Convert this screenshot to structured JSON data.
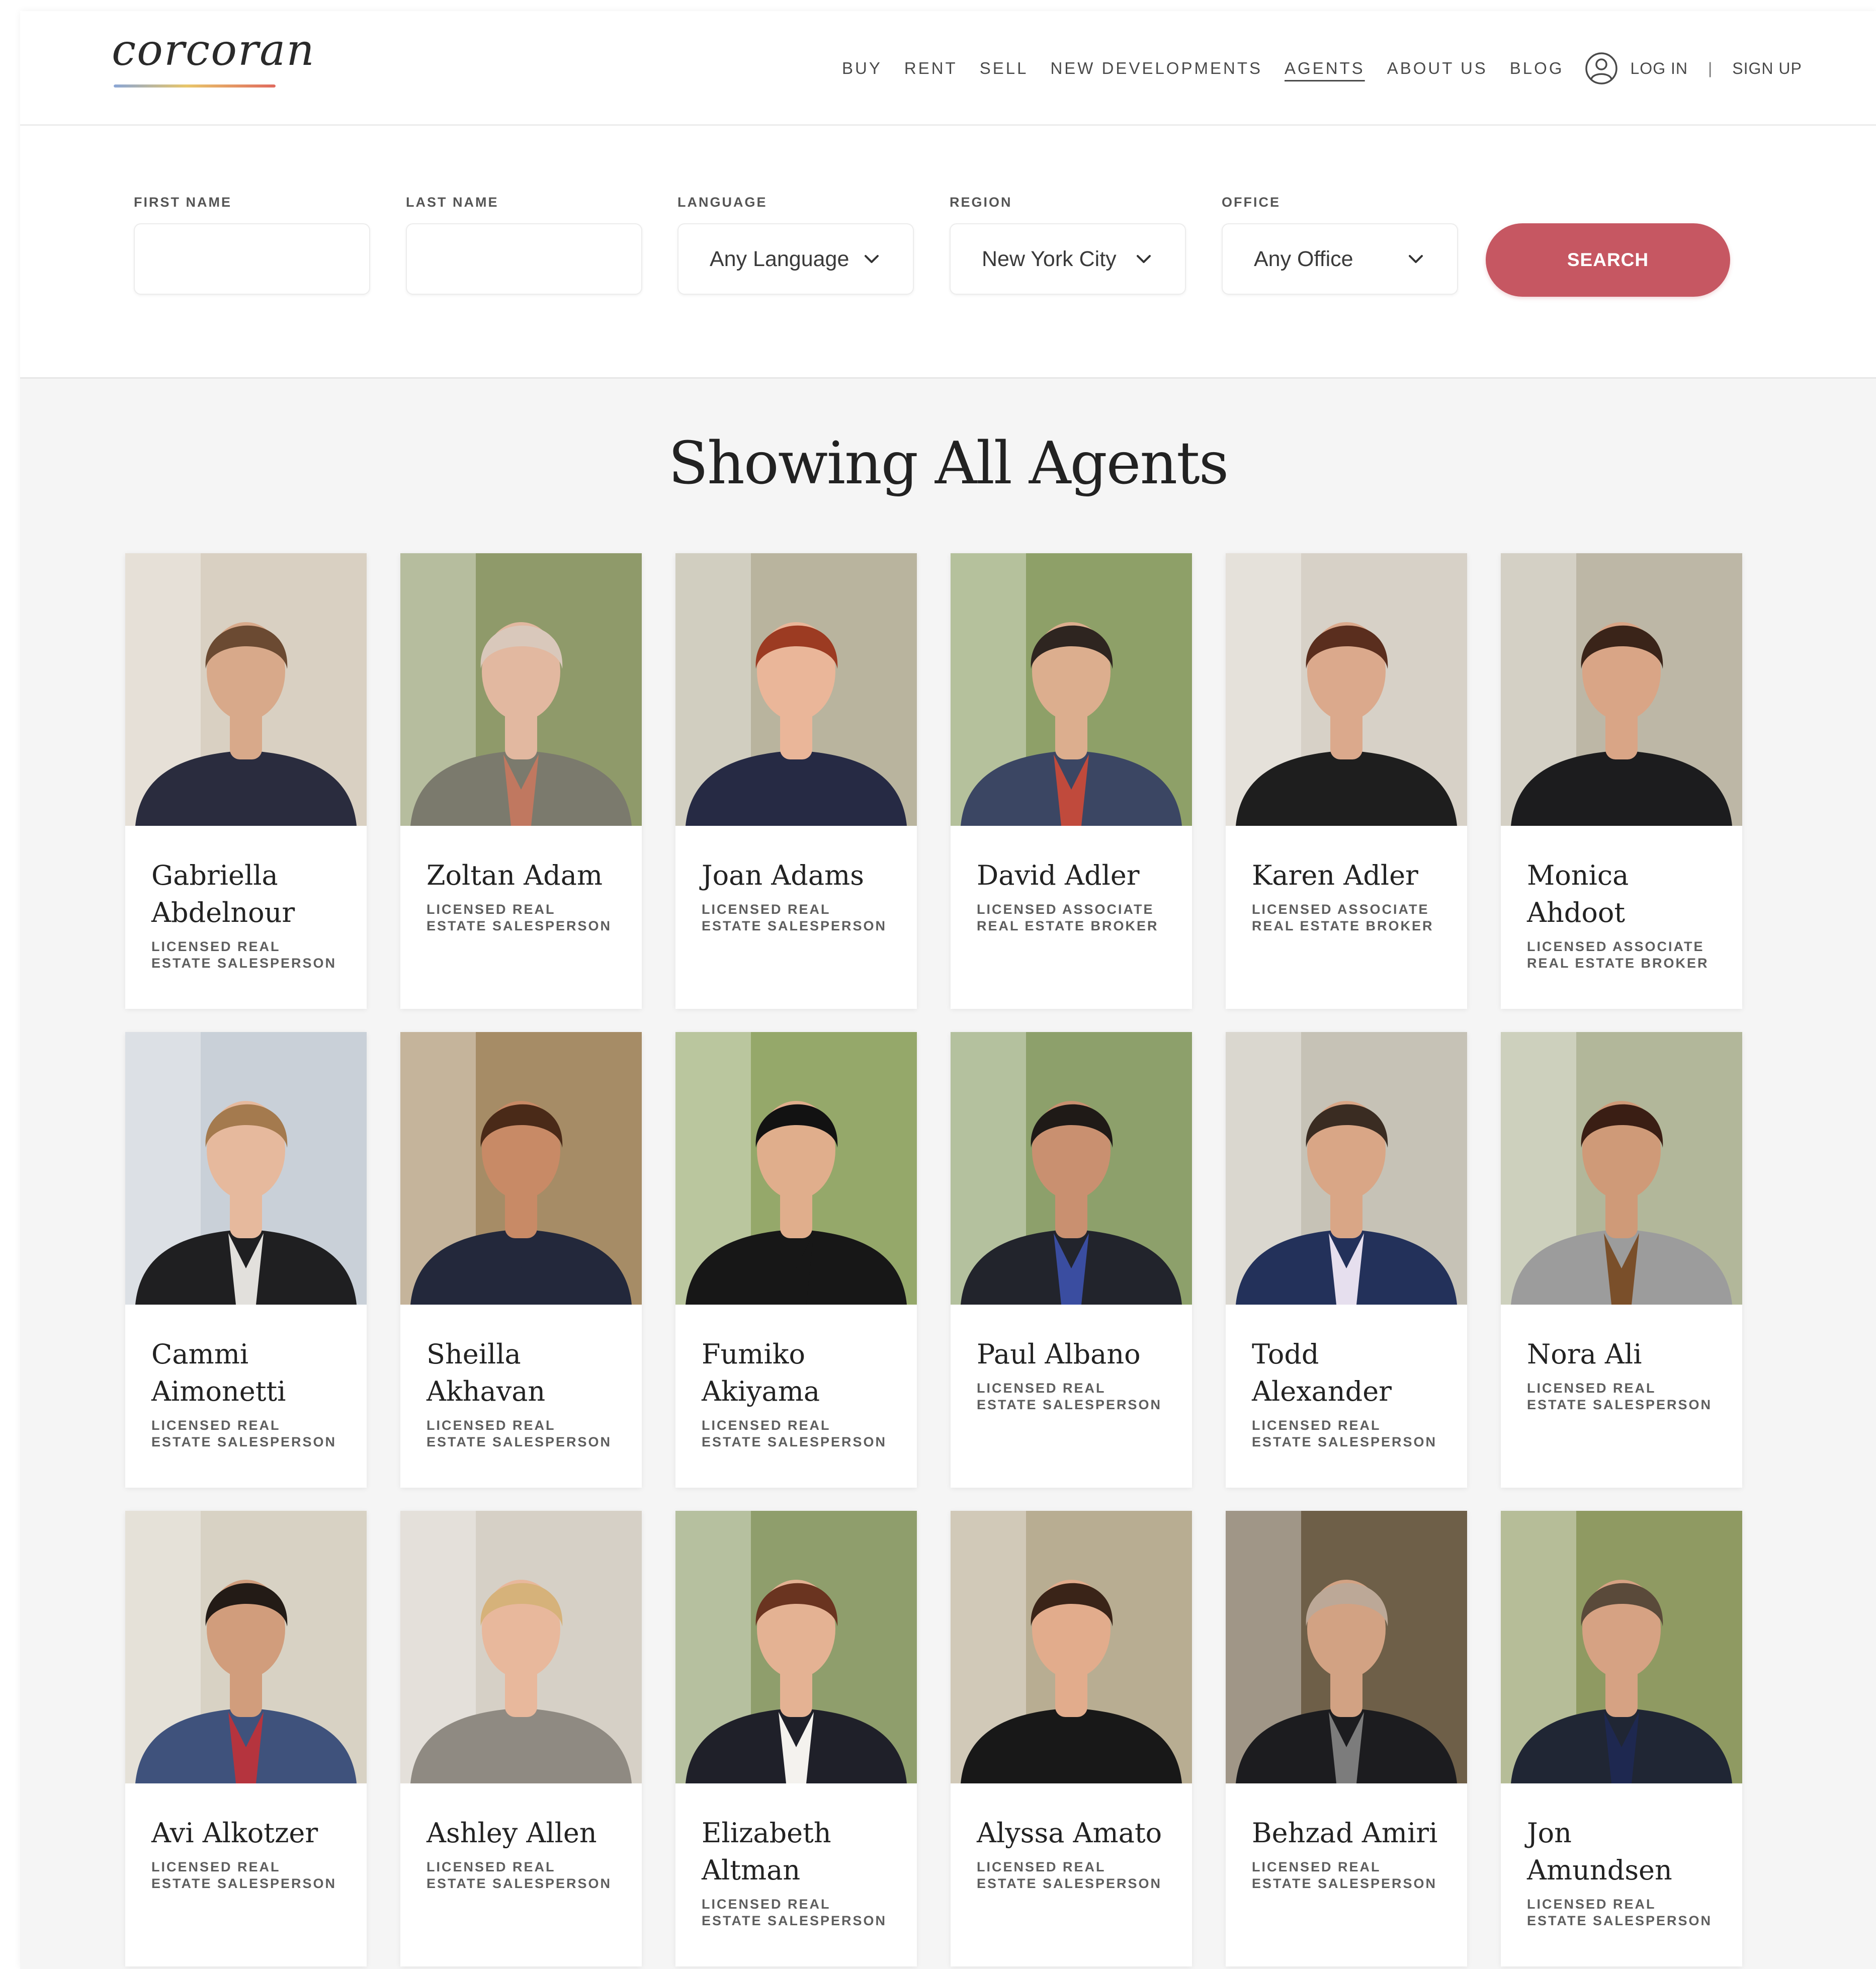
{
  "brand": {
    "logo_text": "corcoran",
    "accent": "#c65762"
  },
  "nav": {
    "items": [
      {
        "label": "BUY",
        "active": false
      },
      {
        "label": "RENT",
        "active": false
      },
      {
        "label": "SELL",
        "active": false
      },
      {
        "label": "NEW DEVELOPMENTS",
        "active": false
      },
      {
        "label": "AGENTS",
        "active": true
      },
      {
        "label": "ABOUT US",
        "active": false
      },
      {
        "label": "BLOG",
        "active": false
      }
    ],
    "login_label": "LOG IN",
    "separator": "|",
    "signup_label": "SIGN UP",
    "user_icon": "user-circle-icon"
  },
  "filters": {
    "first_name": {
      "label": "FIRST NAME",
      "value": "",
      "placeholder": ""
    },
    "last_name": {
      "label": "LAST NAME",
      "value": "",
      "placeholder": ""
    },
    "language": {
      "label": "LANGUAGE",
      "value": "Any Language"
    },
    "region": {
      "label": "REGION",
      "value": "New York City"
    },
    "office": {
      "label": "OFFICE",
      "value": "Any Office"
    },
    "search_label": "SEARCH"
  },
  "results": {
    "title": "Showing All Agents",
    "agents": [
      {
        "name": "Gabriella Abdelnour",
        "title": "Licensed Real Estate Salesperson",
        "photo": {
          "bg": "#d9d0c2",
          "skin": "#d8a98a",
          "hair": "#6b4a32",
          "outfit": "#2a2c3e",
          "accent": "#2a2c3e"
        }
      },
      {
        "name": "Zoltan Adam",
        "title": "Licensed Real Estate Salesperson",
        "photo": {
          "bg": "#8f9a6a",
          "skin": "#e2b8a0",
          "hair": "#d9c8bb",
          "outfit": "#7b7a6d",
          "accent": "#c07860"
        }
      },
      {
        "name": "Joan Adams",
        "title": "Licensed Real Estate Salesperson",
        "photo": {
          "bg": "#b9b49e",
          "skin": "#eab699",
          "hair": "#9c3b22",
          "outfit": "#262a44",
          "accent": "#262a44"
        }
      },
      {
        "name": "David Adler",
        "title": "Licensed Associate Real Estate Broker",
        "photo": {
          "bg": "#8ea068",
          "skin": "#dcae8e",
          "hair": "#2e2520",
          "outfit": "#3b4663",
          "accent": "#c04a3c"
        }
      },
      {
        "name": "Karen Adler",
        "title": "Licensed Associate Real Estate Broker",
        "photo": {
          "bg": "#d7d1c7",
          "skin": "#dba98c",
          "hair": "#5a2e1e",
          "outfit": "#1e1e1e",
          "accent": "#1e1e1e"
        }
      },
      {
        "name": "Monica Ahdoot",
        "title": "Licensed Associate Real Estate Broker",
        "photo": {
          "bg": "#bdb7a6",
          "skin": "#d9a586",
          "hair": "#3a2419",
          "outfit": "#1c1c1e",
          "accent": "#1c1c1e"
        }
      },
      {
        "name": "Cammi Aimonetti",
        "title": "Licensed Real Estate Salesperson",
        "photo": {
          "bg": "#c9d0d8",
          "skin": "#e6b99d",
          "hair": "#a47a4e",
          "outfit": "#1f1f21",
          "accent": "#e2e0dc"
        }
      },
      {
        "name": "Sheilla Akhavan",
        "title": "Licensed Real Estate Salesperson",
        "photo": {
          "bg": "#a68c66",
          "skin": "#c88a66",
          "hair": "#4a2a18",
          "outfit": "#23283b",
          "accent": "#23283b"
        }
      },
      {
        "name": "Fumiko Akiyama",
        "title": "Licensed Real Estate Salesperson",
        "photo": {
          "bg": "#95a86a",
          "skin": "#e0ae8c",
          "hair": "#121212",
          "outfit": "#171717",
          "accent": "#171717"
        }
      },
      {
        "name": "Paul Albano",
        "title": "Licensed Real Estate Salesperson",
        "photo": {
          "bg": "#8da06b",
          "skin": "#c99070",
          "hair": "#1f1a17",
          "outfit": "#22242c",
          "accent": "#3a4da0"
        }
      },
      {
        "name": "Todd Alexander",
        "title": "Licensed Real Estate Salesperson",
        "photo": {
          "bg": "#c6c2b6",
          "skin": "#d9a686",
          "hair": "#3a2c22",
          "outfit": "#23315a",
          "accent": "#e6dfee"
        }
      },
      {
        "name": "Nora Ali",
        "title": "Licensed Real Estate Salesperson",
        "photo": {
          "bg": "#b2b79a",
          "skin": "#cf9a78",
          "hair": "#3a1e14",
          "outfit": "#9c9c9c",
          "accent": "#7a4f2a"
        }
      },
      {
        "name": "Avi Alkotzer",
        "title": "Licensed Real Estate Salesperson",
        "photo": {
          "bg": "#d8d2c4",
          "skin": "#d19d7c",
          "hair": "#231b16",
          "outfit": "#3f527c",
          "accent": "#b5343e"
        }
      },
      {
        "name": "Ashley Allen",
        "title": "Licensed Real Estate Salesperson",
        "photo": {
          "bg": "#d6d0c6",
          "skin": "#e8b89c",
          "hair": "#d6b27a",
          "outfit": "#8f8a82",
          "accent": "#8f8a82"
        }
      },
      {
        "name": "Elizabeth Altman",
        "title": "Licensed Real Estate Salesperson",
        "photo": {
          "bg": "#8f9e6c",
          "skin": "#e4b293",
          "hair": "#6a3420",
          "outfit": "#1f2029",
          "accent": "#f4f2ee"
        }
      },
      {
        "name": "Alyssa Amato",
        "title": "Licensed Real Estate Salesperson",
        "photo": {
          "bg": "#b8ad92",
          "skin": "#e2ac8c",
          "hair": "#3a2418",
          "outfit": "#181818",
          "accent": "#181818"
        }
      },
      {
        "name": "Behzad Amiri",
        "title": "Licensed Real Estate Salesperson",
        "photo": {
          "bg": "#6e5f48",
          "skin": "#d2a283",
          "hair": "#bca897",
          "outfit": "#1c1c1f",
          "accent": "#7c7c7c"
        }
      },
      {
        "name": "Jon Amundsen",
        "title": "Licensed Real Estate Salesperson",
        "photo": {
          "bg": "#8f9a62",
          "skin": "#d6a283",
          "hair": "#5a4a3a",
          "outfit": "#202634",
          "accent": "#1e2850"
        }
      }
    ]
  }
}
